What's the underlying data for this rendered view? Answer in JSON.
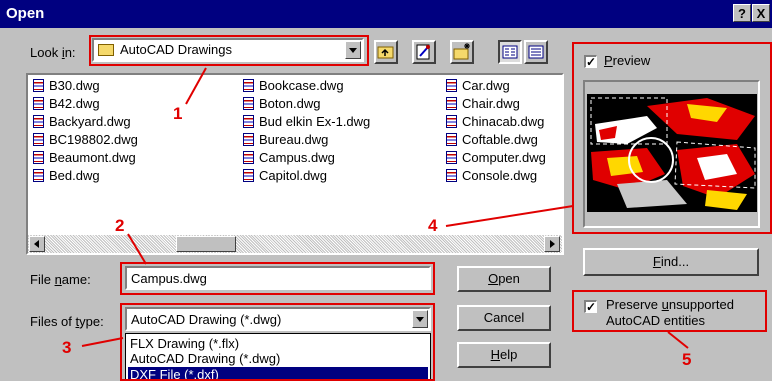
{
  "window": {
    "title": "Open",
    "help_btn": "?",
    "close_btn": "X"
  },
  "look_in": {
    "label_pre": "Look ",
    "label_key": "i",
    "label_post": "n:",
    "value": "AutoCAD Drawings"
  },
  "files": [
    [
      "B30.dwg",
      "B42.dwg",
      "Backyard.dwg",
      "BC198802.dwg",
      "Beaumont.dwg",
      "Bed.dwg"
    ],
    [
      "Bookcase.dwg",
      "Boton.dwg",
      "Bud elkin Ex-1.dwg",
      "Bureau.dwg",
      "Campus.dwg",
      "Capitol.dwg"
    ],
    [
      "Car.dwg",
      "Chair.dwg",
      "Chinacab.dwg",
      "Coftable.dwg",
      "Computer.dwg",
      "Console.dwg"
    ]
  ],
  "file_name": {
    "label_pre": "File ",
    "label_key": "n",
    "label_post": "ame:",
    "value": "Campus.dwg"
  },
  "files_of_type": {
    "label_pre": "Files of ",
    "label_key": "t",
    "label_post": "ype:",
    "value": "AutoCAD Drawing (*.dwg)",
    "options": [
      "FLX Drawing (*.flx)",
      "AutoCAD Drawing (*.dwg)",
      "DXF File (*.dxf)"
    ]
  },
  "buttons": {
    "open_key": "O",
    "open_rest": "pen",
    "cancel": "Cancel",
    "help_key": "H",
    "help_rest": "elp",
    "find_key": "F",
    "find_rest": "ind..."
  },
  "preview": {
    "label_key": "P",
    "label_rest": "review",
    "checked": true
  },
  "preserve": {
    "line1_pre": "Preserve ",
    "line1_key": "u",
    "line1_post": "nsupported",
    "line2": "AutoCAD entities",
    "checked": true
  },
  "callouts": [
    "1",
    "2",
    "3",
    "4",
    "5"
  ],
  "colors": {
    "titlebar": "#000080",
    "callout": "#e00000",
    "selection": "#000080",
    "face": "#c0c0c0"
  },
  "icons": [
    "folder-icon",
    "up-folder-icon",
    "find-file-icon",
    "new-folder-icon",
    "list-view-icon",
    "details-view-icon",
    "dwg-file-icon"
  ]
}
